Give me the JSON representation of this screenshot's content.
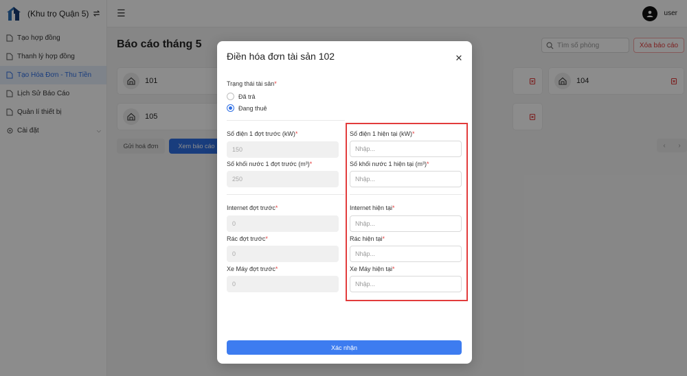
{
  "brand": {
    "name": "(Khu trọ Quận 5)"
  },
  "sidebar": {
    "items": [
      {
        "label": "Tạo hợp đồng",
        "icon": "document-plus-icon"
      },
      {
        "label": "Thanh lý hợp đồng",
        "icon": "document-icon"
      },
      {
        "label": "Tạo Hóa Đơn - Thu Tiền",
        "icon": "document-icon",
        "active": true
      },
      {
        "label": "Lịch Sử Báo Cáo",
        "icon": "document-icon"
      },
      {
        "label": "Quản lí thiết bị",
        "icon": "document-icon"
      },
      {
        "label": "Cài đặt",
        "icon": "settings-icon"
      }
    ]
  },
  "header": {
    "username": "user"
  },
  "page": {
    "title": "Báo cáo tháng 5",
    "search_placeholder": "Tìm số phòng",
    "clear_label": "Xóa báo cáo",
    "rooms": [
      "101",
      "104",
      "105"
    ],
    "send_invoice_label": "Gửi hoá đơn",
    "view_report_label": "Xem báo cáo"
  },
  "modal": {
    "title": "Điền hóa đơn tài sản 102",
    "status_label": "Trạng thái tài sản",
    "status_options": [
      "Đã trả",
      "Đang thuê"
    ],
    "status_selected": "Đang thuê",
    "prev": {
      "electric_label": "Số điện 1 đợt trước (kW)",
      "electric_value": "150",
      "water_label": "Số khối nước 1 đợt trước (m³)",
      "water_value": "250",
      "internet_label": "Internet đợt trước",
      "internet_value": "0",
      "trash_label": "Rác đợt trước",
      "trash_value": "0",
      "bike_label": "Xe Máy đợt trước",
      "bike_value": "0"
    },
    "current": {
      "electric_label": "Số điện 1 hiện tại (kW)",
      "water_label": "Số khối nước 1 hiện tại (m³)",
      "internet_label": "Internet hiện tại",
      "trash_label": "Rác hiện tại",
      "bike_label": "Xe Máy hiện tại",
      "placeholder": "Nhập..."
    },
    "required_mark": "*",
    "submit_label": "Xác nhận"
  },
  "colors": {
    "primary": "#2f6fe4",
    "danger": "#e23b3b",
    "highlight": "#e23b3b"
  }
}
